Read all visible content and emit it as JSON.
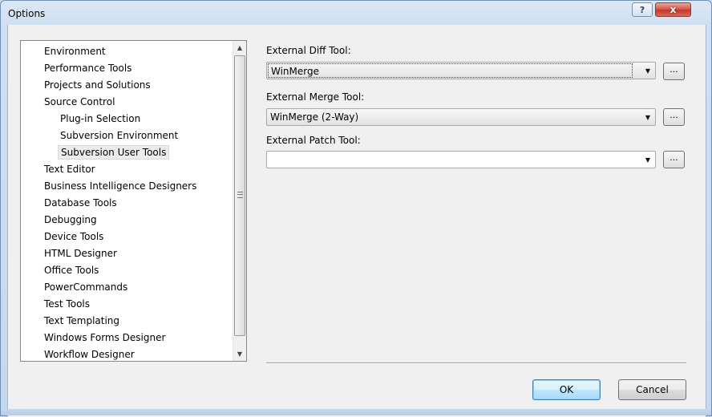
{
  "window": {
    "title": "Options",
    "help_glyph": "?",
    "close_glyph": "x"
  },
  "tree": {
    "items": [
      {
        "label": "Environment",
        "level": 0
      },
      {
        "label": "Performance Tools",
        "level": 0
      },
      {
        "label": "Projects and Solutions",
        "level": 0
      },
      {
        "label": "Source Control",
        "level": 0
      },
      {
        "label": "Plug-in Selection",
        "level": 1
      },
      {
        "label": "Subversion Environment",
        "level": 1
      },
      {
        "label": "Subversion User Tools",
        "level": 1,
        "selected": true
      },
      {
        "label": "Text Editor",
        "level": 0
      },
      {
        "label": "Business Intelligence Designers",
        "level": 0
      },
      {
        "label": "Database Tools",
        "level": 0
      },
      {
        "label": "Debugging",
        "level": 0
      },
      {
        "label": "Device Tools",
        "level": 0
      },
      {
        "label": "HTML Designer",
        "level": 0
      },
      {
        "label": "Office Tools",
        "level": 0
      },
      {
        "label": "PowerCommands",
        "level": 0
      },
      {
        "label": "Test Tools",
        "level": 0
      },
      {
        "label": "Text Templating",
        "level": 0
      },
      {
        "label": "Windows Forms Designer",
        "level": 0
      },
      {
        "label": "Workflow Designer",
        "level": 0
      }
    ],
    "scroll_up_glyph": "▲",
    "scroll_down_glyph": "▼"
  },
  "fields": {
    "diff": {
      "label": "External Diff Tool:",
      "value": "WinMerge"
    },
    "merge": {
      "label": "External Merge Tool:",
      "value": "WinMerge (2-Way)"
    },
    "patch": {
      "label": "External Patch Tool:",
      "value": ""
    },
    "browse_label": "...",
    "dropdown_glyph": "▼"
  },
  "buttons": {
    "ok": "OK",
    "cancel": "Cancel"
  }
}
